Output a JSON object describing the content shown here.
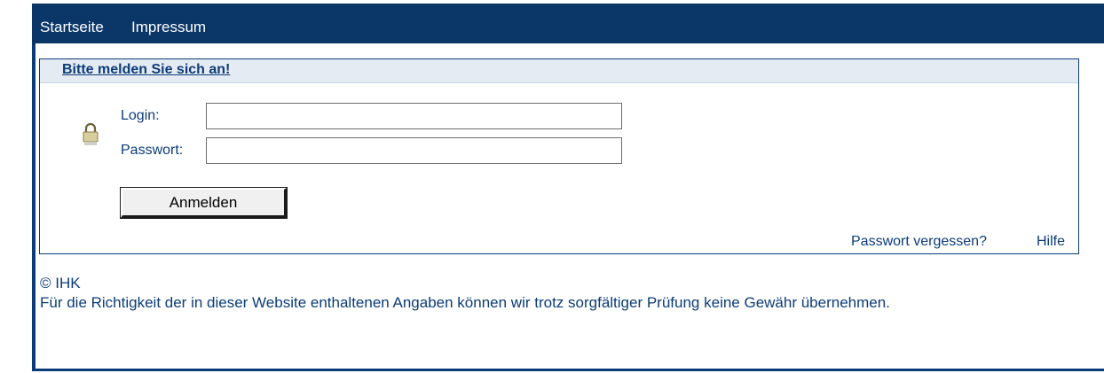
{
  "nav": {
    "home": "Startseite",
    "imprint": "Impressum"
  },
  "login_box": {
    "heading": "Bitte melden Sie sich an!",
    "login_label": "Login:",
    "login_value": "",
    "password_label": "Passwort:",
    "password_value": "",
    "submit_label": "Anmelden",
    "forgot_link": "Passwort vergessen?",
    "help_link": "Hilfe",
    "icon": "lock-icon"
  },
  "footer": {
    "copyright": "© IHK",
    "disclaimer": "Für die Richtigkeit der in dieser Website enthaltenen Angaben können wir trotz sorgfältiger Prüfung keine Gewähr übernehmen."
  },
  "colors": {
    "brand": "#0b3668",
    "text": "#0b3c78",
    "panel_head": "#e5ebf3"
  }
}
